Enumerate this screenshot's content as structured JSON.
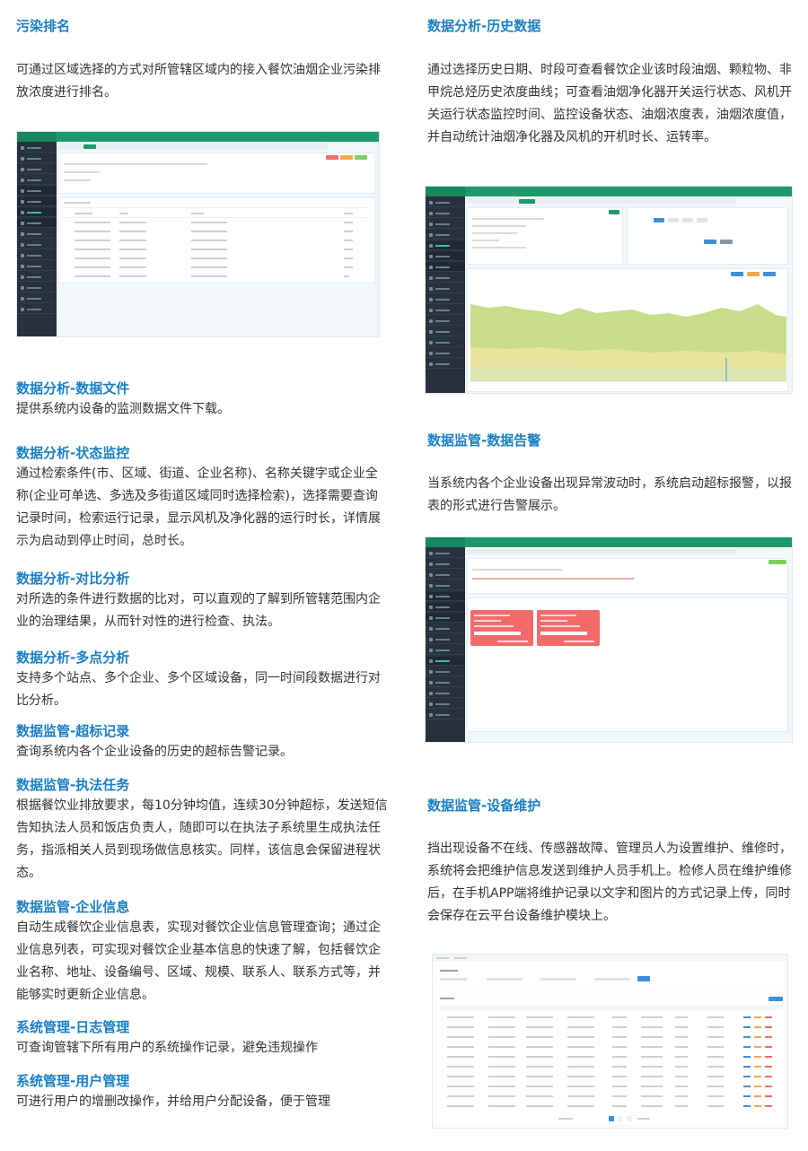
{
  "left": {
    "pollution": {
      "title": "污染排名",
      "body": "可通过区域选择的方式对所管辖区域内的接入餐饮油烟企业污染排放浓度进行排名。"
    },
    "data_file": {
      "title": "数据分析-数据文件",
      "body": "提供系统内设备的监测数据文件下载。"
    },
    "status_monitor": {
      "title": "数据分析-状态监控",
      "body": "通过检索条件(市、区域、街道、企业名称)、名称关键字或企业全称(企业可单选、多选及多街道区域同时选择检索)，选择需要查询记录时间，检索运行记录，显示风机及净化器的运行时长，详情展示为启动到停止时间，总时长。"
    },
    "compare": {
      "title": "数据分析-对比分析",
      "body": "对所选的条件进行数据的比对，可以直观的了解到所管辖范围内企业的治理结果，从而针对性的进行检查、执法。"
    },
    "multipoint": {
      "title": "数据分析-多点分析",
      "body": "支持多个站点、多个企业、多个区域设备，同一时间段数据进行对比分析。"
    },
    "over_record": {
      "title": "数据监管-超标记录",
      "body": "查询系统内各个企业设备的历史的超标告警记录。"
    },
    "enforce": {
      "title": "数据监管-执法任务",
      "body": "根据餐饮业排放要求，每10分钟均值，连续30分钟超标，发送短信告知执法人员和饭店负责人，随即可以在执法子系统里生成执法任务，指派相关人员到现场做信息核实。同样，该信息会保留进程状态。"
    },
    "enterprise": {
      "title": "数据监管-企业信息",
      "body": "自动生成餐饮企业信息表，实现对餐饮企业信息管理查询；通过企业信息列表，可实现对餐饮企业基本信息的快速了解，包括餐饮企业名称、地址、设备编号、区域、规模、联系人、联系方式等，并能够实时更新企业信息。"
    },
    "log": {
      "title": "系统管理-日志管理",
      "body": "可查询管辖下所有用户的系统操作记录，避免违规操作"
    },
    "user": {
      "title": "系统管理-用户管理",
      "body": "可进行用户的增删改操作，并给用户分配设备，便于管理"
    }
  },
  "right": {
    "history": {
      "title": "数据分析-历史数据",
      "body": "通过选择历史日期、时段可查看餐饮企业该时段油烟、颗粒物、非甲烷总烃历史浓度曲线；可查看油烟净化器开关运行状态、风机开关运行状态监控时间、监控设备状态、油烟浓度表，油烟浓度值，并自动统计油烟净化器及风机的开机时长、运转率。"
    },
    "alarm": {
      "title": "数据监管-数据告警",
      "body": "当系统内各个企业设备出现异常波动时，系统启动超标报警，以报表的形式进行告警展示。"
    },
    "maintain": {
      "title": "数据监管-设备维护",
      "body": "挡出现设备不在线、传感器故障、管理员人为设置维护、维修时，系统将会把维护信息发送到维护人员手机上。检修人员在维护维修后，在手机APP端将维护记录以文字和图片的方式记录上传，同时会保存在云平台设备维护模块上。"
    }
  },
  "colors": {
    "title": "#1a7fc4",
    "topbar": "#1d9a6c",
    "sidebar": "#27323e",
    "alarm": "#f26b6b",
    "chart_fill": "#c9dc8a"
  }
}
